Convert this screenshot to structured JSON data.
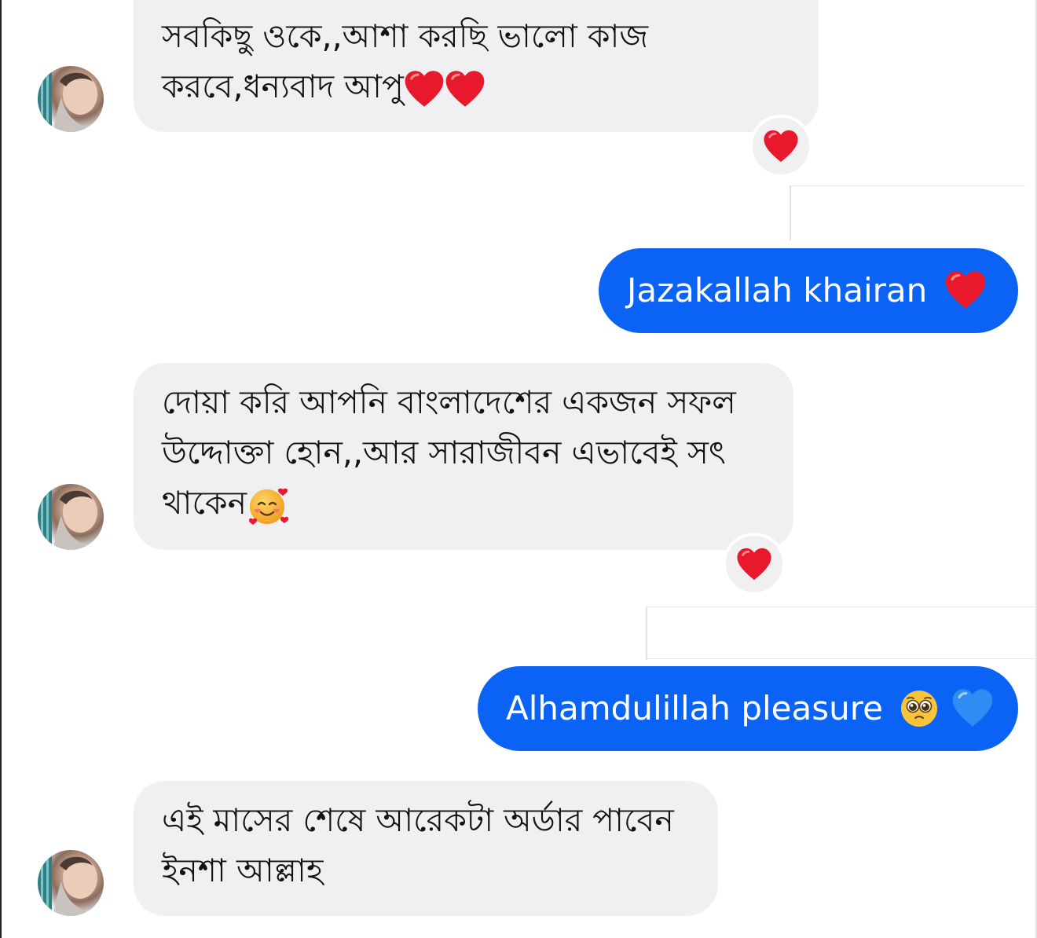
{
  "messages": [
    {
      "id": "m1",
      "direction": "incoming",
      "lines": [
        "সবকিছু ওকে,,আশা করছি ভালো কাজ",
        "করবে,ধন্যবাদ আপু"
      ],
      "trailing_emoji": [
        "red-heart",
        "red-heart"
      ],
      "reaction": "red-heart"
    },
    {
      "id": "m2",
      "direction": "outgoing",
      "text": "Jazakallah khairan",
      "trailing_emoji": [
        "red-heart"
      ]
    },
    {
      "id": "m3",
      "direction": "incoming",
      "lines": [
        "দোয়া করি আপনি বাংলাদেশের একজন সফল",
        "উদ্দোক্তা হোন,,আর সারাজীবন এভাবেই সৎ",
        "থাকেন"
      ],
      "trailing_emoji": [
        "smiling-face-with-hearts"
      ],
      "reaction": "red-heart"
    },
    {
      "id": "m4",
      "direction": "outgoing",
      "text": "Alhamdulillah pleasure",
      "trailing_emoji": [
        "pleading-face",
        "blue-heart"
      ]
    },
    {
      "id": "m5",
      "direction": "incoming",
      "lines": [
        "এই মাসের শেষে আরেকটা অর্ডার পাবেন",
        "ইনশা আল্লাহ"
      ]
    }
  ],
  "colors": {
    "outgoing_bubble": "#0b63f6",
    "incoming_bubble": "#f0f0f3",
    "heart_red": "#e8192c",
    "heart_blue": "#2f8cf2"
  }
}
